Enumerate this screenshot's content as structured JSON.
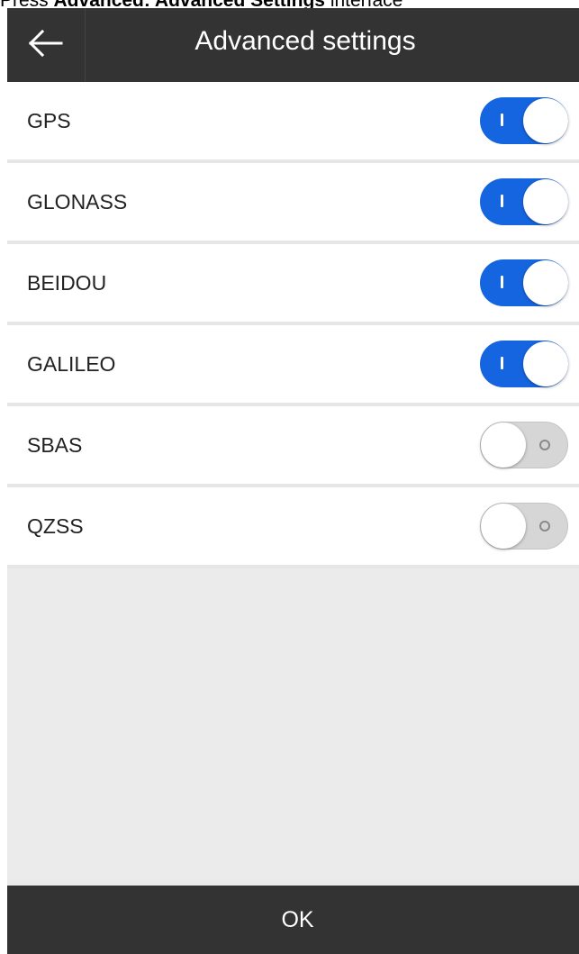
{
  "caption": {
    "prefix": "Press ",
    "bold_text": "Advanced: Advanced Settings",
    "suffix": " interface"
  },
  "header": {
    "back_icon": "arrow-left-icon",
    "title": "Advanced settings"
  },
  "settings": [
    {
      "label": "GPS",
      "enabled": true
    },
    {
      "label": "GLONASS",
      "enabled": true
    },
    {
      "label": "BEIDOU",
      "enabled": true
    },
    {
      "label": "GALILEO",
      "enabled": true
    },
    {
      "label": "SBAS",
      "enabled": false
    },
    {
      "label": "QZSS",
      "enabled": false
    }
  ],
  "footer": {
    "ok_label": "OK"
  },
  "colors": {
    "header_bg": "#333333",
    "toggle_on": "#1565e0",
    "toggle_off": "#d6d6d6",
    "page_bg": "#ebebeb"
  }
}
